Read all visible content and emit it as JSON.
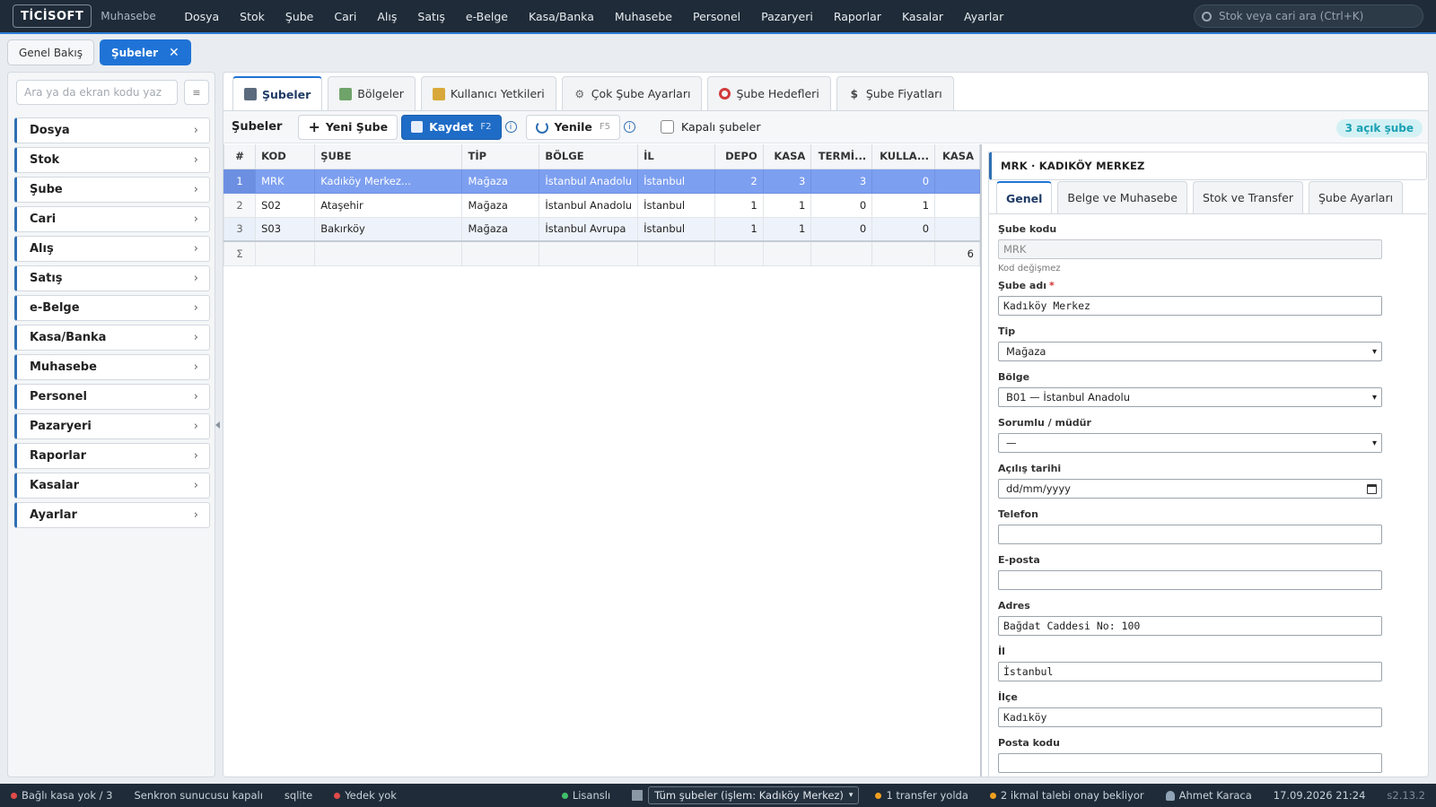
{
  "topbar": {
    "logo": "TİCİSOFT",
    "app_name": "Muhasebe",
    "menu": [
      "Dosya",
      "Stok",
      "Şube",
      "Cari",
      "Alış",
      "Satış",
      "e-Belge",
      "Kasa/Banka",
      "Muhasebe",
      "Personel",
      "Pazaryeri",
      "Raporlar",
      "Kasalar",
      "Ayarlar"
    ],
    "search_placeholder": "Stok veya cari ara (Ctrl+K)"
  },
  "doc_tabs": {
    "overview": "Genel Bakış",
    "active": "Şubeler",
    "close_glyph": "✕"
  },
  "sidebar": {
    "search_placeholder": "Ara ya da ekran kodu yaz",
    "menu_glyph": "≡",
    "items": [
      "Dosya",
      "Stok",
      "Şube",
      "Cari",
      "Alış",
      "Satış",
      "e-Belge",
      "Kasa/Banka",
      "Muhasebe",
      "Personel",
      "Pazaryeri",
      "Raporlar",
      "Kasalar",
      "Ayarlar"
    ],
    "chevron": "›"
  },
  "main_tabs": [
    "Şubeler",
    "Bölgeler",
    "Kullanıcı Yetkileri",
    "Çok Şube Ayarları",
    "Şube Hedefleri",
    "Şube Fiyatları"
  ],
  "toolbar": {
    "title": "Şubeler",
    "new_label": "Yeni Şube",
    "save_label": "Kaydet",
    "save_key": "F2",
    "refresh_label": "Yenile",
    "refresh_key": "F5",
    "closed_label": "Kapalı şubeler",
    "open_badge": "3 açık şube"
  },
  "grid": {
    "columns": [
      "#",
      "KOD",
      "ŞUBE",
      "TİP",
      "BÖLGE",
      "İL",
      "DEPO",
      "KASA",
      "TERMİ...",
      "KULLA...",
      "KASA"
    ],
    "rows": [
      [
        "1",
        "MRK",
        "Kadıköy Merkez...",
        "Mağaza",
        "İstanbul Anadolu",
        "İstanbul",
        "2",
        "3",
        "3",
        "0",
        ""
      ],
      [
        "2",
        "S02",
        "Ataşehir",
        "Mağaza",
        "İstanbul Anadolu",
        "İstanbul",
        "1",
        "1",
        "0",
        "1",
        ""
      ],
      [
        "3",
        "S03",
        "Bakırköy",
        "Mağaza",
        "İstanbul Avrupa",
        "İstanbul",
        "1",
        "1",
        "0",
        "0",
        ""
      ]
    ],
    "sum_symbol": "Σ",
    "sum_last": "6"
  },
  "detail": {
    "header": "MRK · KADIKÖY MERKEZ",
    "tabs": [
      "Genel",
      "Belge ve Muhasebe",
      "Stok ve Transfer",
      "Şube Ayarları"
    ],
    "fields": {
      "code_label": "Şube kodu",
      "code_value": "MRK",
      "code_hint": "Kod değişmez",
      "name_label": "Şube adı",
      "name_value": "Kadıköy Merkez",
      "type_label": "Tip",
      "type_value": "Mağaza",
      "region_label": "Bölge",
      "region_value": "B01 — İstanbul Anadolu",
      "manager_label": "Sorumlu / müdür",
      "manager_value": "—",
      "open_date_label": "Açılış tarihi",
      "open_date_value": "dd/mm/yyyy",
      "phone_label": "Telefon",
      "phone_value": "",
      "email_label": "E-posta",
      "email_value": "",
      "address_label": "Adres",
      "address_value": "Bağdat Caddesi No: 100",
      "city_label": "İl",
      "city_value": "İstanbul",
      "district_label": "İlçe",
      "district_value": "Kadıköy",
      "postal_label": "Posta kodu",
      "postal_value": ""
    }
  },
  "statusbar": {
    "kasa": "Bağlı kasa yok / 3",
    "sync": "Senkron sunucusu kapalı",
    "db": "sqlite",
    "backup": "Yedek yok",
    "license": "Lisanslı",
    "branch_select": "Tüm şubeler (işlem: Kadıköy Merkez)",
    "transfer": "1 transfer yolda",
    "approval": "2 ikmal talebi onay bekliyor",
    "user": "Ahmet Karaca",
    "datetime": "17.09.2026 21:24",
    "version": "s2.13.2"
  },
  "colors": {
    "accent": "#1f73d6",
    "topbar_bg": "#1f2b38",
    "selected_row": "#7d9ff0",
    "status_red": "#e04b4b",
    "status_green": "#3fbf6a",
    "status_orange": "#f0a020"
  }
}
